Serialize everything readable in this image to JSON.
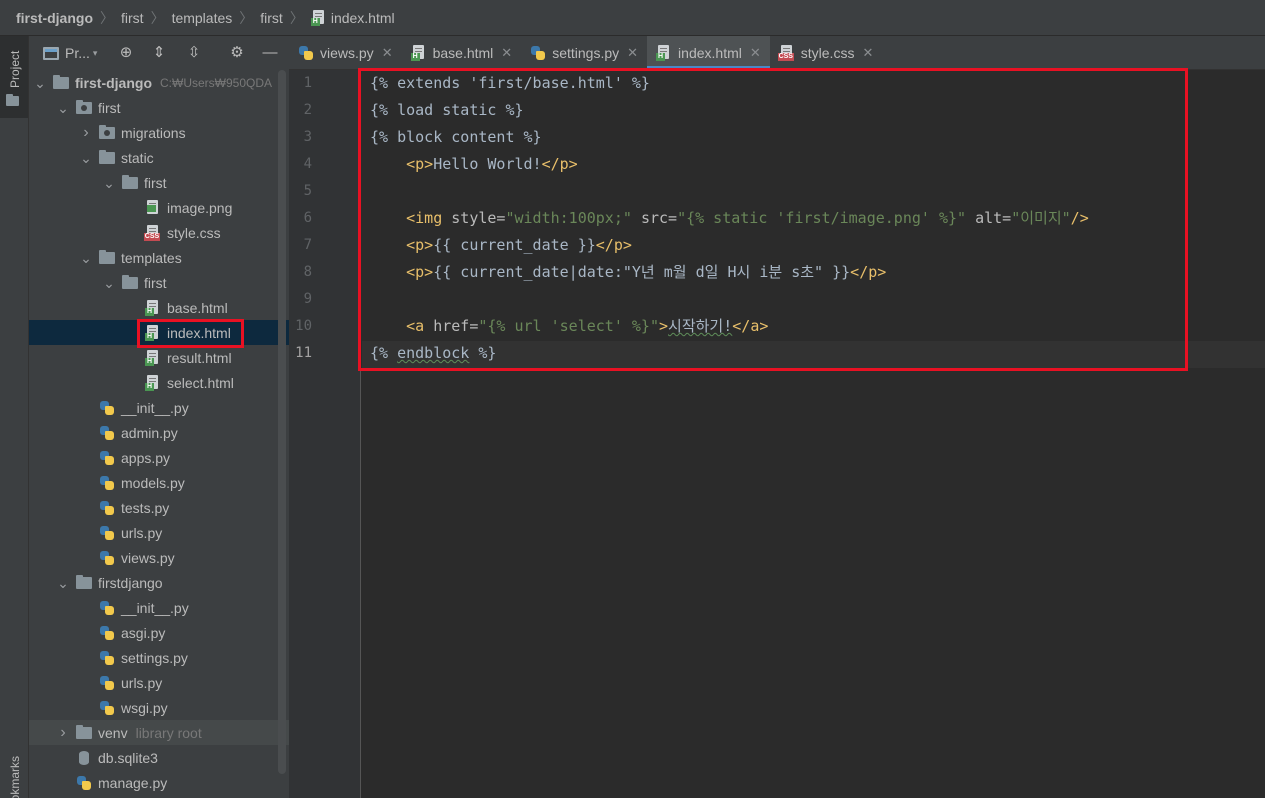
{
  "breadcrumb": [
    "first-django",
    "first",
    "templates",
    "first",
    "index.html"
  ],
  "toolstrip": {
    "project_label": "Project",
    "bookmarks_label": "Bookmarks"
  },
  "panel": {
    "title": "Pr...",
    "project_path": "C:\\Users\\950QDA"
  },
  "tree": [
    {
      "label": "first-django",
      "icon": "folder",
      "extra": "C:₩Users₩950QDA",
      "bold": true
    },
    {
      "label": "first",
      "icon": "folder-dot"
    },
    {
      "label": "migrations",
      "icon": "folder-dot"
    },
    {
      "label": "static",
      "icon": "folder"
    },
    {
      "label": "first",
      "icon": "folder"
    },
    {
      "label": "image.png",
      "icon": "image"
    },
    {
      "label": "style.css",
      "icon": "css"
    },
    {
      "label": "templates",
      "icon": "folder"
    },
    {
      "label": "first",
      "icon": "folder"
    },
    {
      "label": "base.html",
      "icon": "html"
    },
    {
      "label": "index.html",
      "icon": "html"
    },
    {
      "label": "result.html",
      "icon": "html"
    },
    {
      "label": "select.html",
      "icon": "html"
    },
    {
      "label": "__init__.py",
      "icon": "python"
    },
    {
      "label": "admin.py",
      "icon": "python"
    },
    {
      "label": "apps.py",
      "icon": "python"
    },
    {
      "label": "models.py",
      "icon": "python"
    },
    {
      "label": "tests.py",
      "icon": "python"
    },
    {
      "label": "urls.py",
      "icon": "python"
    },
    {
      "label": "views.py",
      "icon": "python"
    },
    {
      "label": "firstdjango",
      "icon": "folder"
    },
    {
      "label": "__init__.py",
      "icon": "python"
    },
    {
      "label": "asgi.py",
      "icon": "python"
    },
    {
      "label": "settings.py",
      "icon": "python"
    },
    {
      "label": "urls.py",
      "icon": "python"
    },
    {
      "label": "wsgi.py",
      "icon": "python"
    },
    {
      "label": "venv",
      "icon": "folder",
      "extra": "library root"
    },
    {
      "label": "db.sqlite3",
      "icon": "db"
    },
    {
      "label": "manage.py",
      "icon": "python"
    }
  ],
  "tabs": [
    {
      "label": "views.py",
      "icon": "python"
    },
    {
      "label": "base.html",
      "icon": "html"
    },
    {
      "label": "settings.py",
      "icon": "python"
    },
    {
      "label": "index.html",
      "icon": "html",
      "active": true
    },
    {
      "label": "style.css",
      "icon": "css"
    }
  ],
  "line_numbers": [
    "1",
    "2",
    "3",
    "4",
    "5",
    "6",
    "7",
    "8",
    "9",
    "10",
    "11"
  ],
  "code": {
    "l1": "{% extends 'first/base.html' %}",
    "l2": "{% load static %}",
    "l3": "{% block content %}",
    "l4_text": "Hello World!",
    "l6_style": "\"width:100px;\"",
    "l6_src": "\"{% static 'first/image.png' %}\"",
    "l6_alt": "\"이미지\"",
    "l7_text": "{{ current_date }}",
    "l8_text": "{{ current_date|date:\"Y년 m월 d일 H시 i분 s초\" }}",
    "l10_href": "\"{% url 'select' %}\"",
    "l10_text": "시작하기!",
    "l11_a": "{% ",
    "l11_b": "endblock",
    "l11_c": " %}"
  }
}
